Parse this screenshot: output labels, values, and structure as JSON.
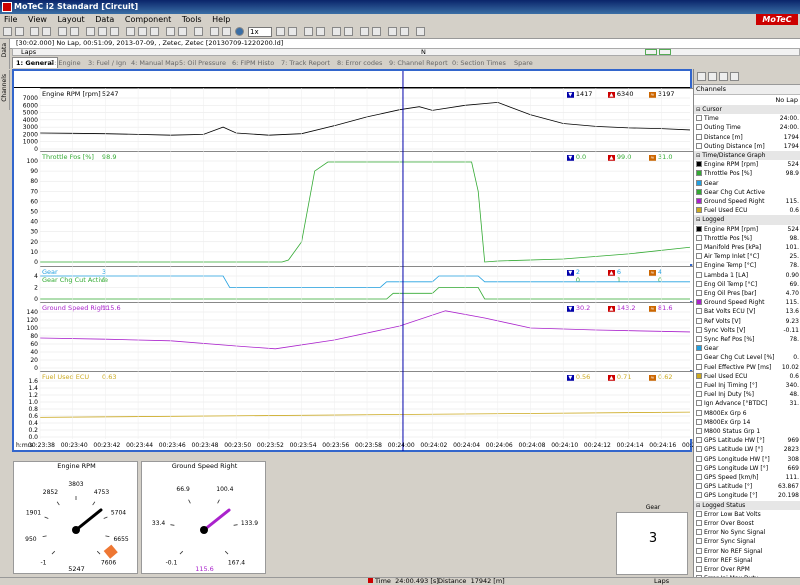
{
  "window": {
    "title": "MoTeC i2 Standard [Circuit]",
    "brand": "MoTeC"
  },
  "menu": [
    "File",
    "View",
    "Layout",
    "Data",
    "Component",
    "Tools",
    "Help"
  ],
  "toolbar": {
    "zoom_select": "1x"
  },
  "infobar": {
    "text": "[30:02.000] No Lap, 00:51:09, 2013-07-09, , Zetec, Zetec [20130709-1220200.ld]"
  },
  "laps": {
    "label": "Laps",
    "marker": "N"
  },
  "tabs": [
    "1: General",
    "2: Engine",
    "3: Fuel / Ign",
    "4: Manual Map",
    "5: Oil Pressure",
    "6: FIPM Histo",
    "7: Track Report",
    "8: Error codes",
    "9: Channel Report",
    "0: Section Times",
    "Spare"
  ],
  "side_tabs": [
    "Data",
    "Channels"
  ],
  "panels": {
    "rpm": {
      "label": "Engine RPM [rpm]",
      "value": "5247",
      "stats": [
        "1417",
        "6340",
        "3197"
      ],
      "axis": [
        "7000",
        "6000",
        "5000",
        "4000",
        "3000",
        "2000",
        "1000",
        "0"
      ]
    },
    "throttle": {
      "label": "Throttle Pos [%]",
      "value": "98.9",
      "stats": [
        "0.0",
        "99.0",
        "31.0"
      ],
      "axis": [
        "100",
        "90",
        "80",
        "70",
        "60",
        "50",
        "40",
        "30",
        "20",
        "10",
        "0"
      ]
    },
    "gear": {
      "label1": "Gear",
      "value1": "3",
      "label2": "Gear Chg Cut Active",
      "value2": "0",
      "stats1": [
        "2",
        "6",
        "4"
      ],
      "stats2": [
        "0",
        "1",
        "0"
      ],
      "axis": [
        "4",
        "2",
        "0"
      ]
    },
    "speed": {
      "label": "Ground Speed Right",
      "value": "115.6",
      "stats": [
        "30.2",
        "143.2",
        "81.6"
      ],
      "axis": [
        "140",
        "120",
        "100",
        "80",
        "60",
        "40",
        "20",
        "0"
      ]
    },
    "fuel": {
      "label": "Fuel Used ECU",
      "value": "0.63",
      "stats": [
        "0.56",
        "0.71",
        "0.62"
      ],
      "axis": [
        "1.6",
        "1.4",
        "1.2",
        "1.0",
        "0.8",
        "0.6",
        "0.4",
        "0.2",
        "0.0"
      ]
    }
  },
  "x_axis": {
    "unit": "h:m:s",
    "ticks": [
      "00:23:38",
      "00:23:40",
      "00:23:42",
      "00:23:44",
      "00:23:46",
      "00:23:48",
      "00:23:50",
      "00:23:52",
      "00:23:54",
      "00:23:56",
      "00:23:58",
      "00:24:00",
      "00:24:02",
      "00:24:04",
      "00:24:06",
      "00:24:08",
      "00:24:10",
      "00:24:12",
      "00:24:14",
      "00:24:16",
      "00:24:18"
    ]
  },
  "chart_data": [
    {
      "type": "line",
      "title": "Engine RPM [rpm]",
      "ylim": [
        0,
        7000
      ],
      "x": [
        0,
        0.05,
        0.1,
        0.15,
        0.2,
        0.25,
        0.28,
        0.3,
        0.35,
        0.4,
        0.45,
        0.5,
        0.55,
        0.58,
        0.6,
        0.65,
        0.7,
        0.75,
        0.8,
        0.85,
        0.9,
        0.95,
        1
      ],
      "values": [
        2200,
        2150,
        2100,
        2000,
        1900,
        2000,
        3000,
        2200,
        1900,
        2100,
        3200,
        4400,
        5400,
        5800,
        5300,
        6000,
        6400,
        4700,
        3500,
        3100,
        2900,
        2800,
        2600
      ]
    },
    {
      "type": "line",
      "title": "Throttle Pos [%]",
      "ylim": [
        0,
        100
      ],
      "x": [
        0,
        0.3,
        0.37,
        0.38,
        0.4,
        0.42,
        0.44,
        0.66,
        0.67,
        0.68,
        0.7,
        0.8,
        0.9,
        1
      ],
      "values": [
        0,
        0,
        0,
        2,
        20,
        90,
        99,
        99,
        70,
        0,
        1,
        3,
        8,
        15
      ]
    },
    {
      "type": "line",
      "title": "Gear",
      "ylim": [
        0,
        4
      ],
      "x": [
        0,
        0.28,
        0.29,
        0.52,
        0.53,
        0.6,
        0.61,
        0.67,
        0.68,
        1
      ],
      "values": [
        4,
        4,
        2,
        2,
        3,
        3,
        4,
        4,
        3,
        3
      ]
    },
    {
      "type": "line",
      "title": "Ground Speed Right",
      "ylim": [
        0,
        140
      ],
      "x": [
        0,
        0.1,
        0.2,
        0.3,
        0.36,
        0.45,
        0.55,
        0.62,
        0.68,
        0.75,
        0.85,
        1
      ],
      "values": [
        75,
        72,
        68,
        55,
        48,
        70,
        105,
        143,
        125,
        100,
        95,
        90
      ]
    },
    {
      "type": "line",
      "title": "Fuel Used ECU",
      "ylim": [
        0,
        1.6
      ],
      "x": [
        0,
        1
      ],
      "values": [
        0.56,
        0.71
      ]
    }
  ],
  "channels": {
    "header": "Channels",
    "lap": "No Lap",
    "rows": [
      {
        "g": 1,
        "n": "Cursor"
      },
      {
        "n": "Time",
        "v": "24:00.",
        "c": "#ffffff"
      },
      {
        "n": "Outing Time",
        "v": "24:00.",
        "c": "#ffffff"
      },
      {
        "n": "Distance [m]",
        "v": "1794",
        "c": "#ffffff"
      },
      {
        "n": "Outing Distance [m]",
        "v": "1794",
        "c": "#ffffff"
      },
      {
        "g": 1,
        "n": "Time/Distance Graph"
      },
      {
        "n": "Engine RPM [rpm]",
        "v": "524",
        "c": "#000000"
      },
      {
        "n": "Throttle Pos [%]",
        "v": "98.9",
        "c": "#33aa33"
      },
      {
        "n": "Gear",
        "v": "",
        "c": "#22a0e0"
      },
      {
        "n": "Gear Chg Cut Active",
        "v": "",
        "c": "#33aa33"
      },
      {
        "n": "Ground Speed Right",
        "v": "115.",
        "c": "#aa22cc"
      },
      {
        "n": "Fuel Used ECU",
        "v": "0.6",
        "c": "#ccaa22"
      },
      {
        "g": 1,
        "n": "Logged"
      },
      {
        "n": "Engine RPM [rpm]",
        "v": "524",
        "c": "#000000"
      },
      {
        "n": "Throttle Pos [%]",
        "v": "98.",
        "c": "#ffffff"
      },
      {
        "n": "Manifold Pres [kPa]",
        "v": "101.",
        "c": "#ffffff"
      },
      {
        "n": "Air Temp Inlet [°C]",
        "v": "25.",
        "c": "#ffffff"
      },
      {
        "n": "Engine Temp [°C]",
        "v": "78.",
        "c": "#ffffff"
      },
      {
        "n": "Lambda 1 [LA]",
        "v": "0.90",
        "c": "#ffffff"
      },
      {
        "n": "Eng Oil Temp [°C]",
        "v": "69.",
        "c": "#ffffff"
      },
      {
        "n": "Eng Oil Pres [bar]",
        "v": "4.70",
        "c": "#ffffff"
      },
      {
        "n": "Ground Speed Right",
        "v": "115.",
        "c": "#aa22cc"
      },
      {
        "n": "Bat Volts ECU [V]",
        "v": "13.6",
        "c": "#ffffff"
      },
      {
        "n": "Ref Volts [V]",
        "v": "9.23",
        "c": "#ffffff"
      },
      {
        "n": "Sync Volts [V]",
        "v": "-0.11",
        "c": "#ffffff"
      },
      {
        "n": "Sync Ref Pos [%]",
        "v": "78.",
        "c": "#ffffff"
      },
      {
        "n": "Gear",
        "v": "",
        "c": "#22a0e0"
      },
      {
        "n": "Gear Chg Cut Level [%]",
        "v": "0.",
        "c": "#ffffff"
      },
      {
        "n": "Fuel Effective PW [ms]",
        "v": "10.02",
        "c": "#ffffff"
      },
      {
        "n": "Fuel Used ECU",
        "v": "0.6",
        "c": "#ccaa22"
      },
      {
        "n": "Fuel Inj Timing [°]",
        "v": "340.",
        "c": "#ffffff"
      },
      {
        "n": "Fuel Inj Duty [%]",
        "v": "48.",
        "c": "#ffffff"
      },
      {
        "n": "Ign Advance [°BTDC]",
        "v": "31.",
        "c": "#ffffff"
      },
      {
        "n": "M800Ex Grp 6",
        "v": "",
        "c": "#ffffff"
      },
      {
        "n": "M800Ex Grp 14",
        "v": "",
        "c": "#ffffff"
      },
      {
        "n": "M800 Status Grp 1",
        "v": "",
        "c": "#ffffff"
      },
      {
        "n": "GPS Latitude HW [°]",
        "v": "969",
        "c": "#ffffff"
      },
      {
        "n": "GPS Latitude LW [°]",
        "v": "2823",
        "c": "#ffffff"
      },
      {
        "n": "GPS Longitude HW [°]",
        "v": "308",
        "c": "#ffffff"
      },
      {
        "n": "GPS Longitude LW [°]",
        "v": "669",
        "c": "#ffffff"
      },
      {
        "n": "GPS Speed [km/h]",
        "v": "111.",
        "c": "#ffffff"
      },
      {
        "n": "GPS Latitude [°]",
        "v": "63.867",
        "c": "#ffffff"
      },
      {
        "n": "GPS Longitude [°]",
        "v": "20.198",
        "c": "#ffffff"
      },
      {
        "g": 1,
        "n": "Logged Status"
      },
      {
        "n": "Error Low Bat Volts",
        "v": "",
        "c": "#ffffff"
      },
      {
        "n": "Error Over Boost",
        "v": "",
        "c": "#ffffff"
      },
      {
        "n": "Error No Sync Signal",
        "v": "",
        "c": "#ffffff"
      },
      {
        "n": "Error Sync Signal",
        "v": "",
        "c": "#ffffff"
      },
      {
        "n": "Error No REF Signal",
        "v": "",
        "c": "#ffffff"
      },
      {
        "n": "Error REF Signal",
        "v": "",
        "c": "#ffffff"
      },
      {
        "n": "Error Over RPM",
        "v": "",
        "c": "#ffffff"
      },
      {
        "n": "Error Inj Max Duty",
        "v": "",
        "c": "#ffffff"
      },
      {
        "n": "Error Sync Lo Level",
        "v": "",
        "c": "#ffffff"
      },
      {
        "n": "Error Sync Runt",
        "v": "",
        "c": "#ffffff"
      }
    ]
  },
  "gauges": {
    "rpm": {
      "title": "Engine RPM",
      "value": "5247",
      "ticks": [
        "-1",
        "950",
        "1901",
        "2852",
        "3803",
        "4753",
        "5704",
        "6655",
        "7606"
      ]
    },
    "speed": {
      "title": "Ground Speed Right",
      "value": "115.6",
      "ticks": [
        "-0.1",
        "33.4",
        "66.9",
        "100.4",
        "133.9",
        "167.4"
      ]
    },
    "gear": {
      "title": "Gear",
      "value": "3"
    }
  },
  "status": {
    "time_label": "Time",
    "time_value": "24:00.493 [s]",
    "dist_label": "Distance",
    "dist_value": "17942 [m]",
    "laps": "Laps"
  },
  "colors": {
    "rpm": "#000000",
    "throttle": "#33aa33",
    "gear": "#22a0e0",
    "speed": "#aa22cc",
    "fuel": "#ccaa22",
    "cursor": "#0000aa",
    "frame": "#3366cc"
  }
}
